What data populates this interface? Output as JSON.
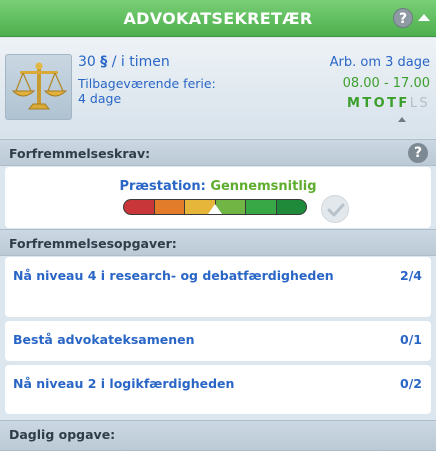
{
  "header": {
    "title": "Advokatsekretær",
    "help_label": "?",
    "collapse_icon": "chevron-up-icon"
  },
  "career": {
    "icon": "scales-of-justice-icon",
    "wage_amount": "30",
    "wage_currency": "§",
    "wage_unit": "/ i timen",
    "vacation_label": "Tilbageværende ferie:",
    "vacation_value": "4 dage",
    "work_in": "Arb. om 3 dage",
    "work_hours": "08.00 - 17.00",
    "days": [
      {
        "letter": "M",
        "active": true
      },
      {
        "letter": "T",
        "active": true
      },
      {
        "letter": "O",
        "active": true
      },
      {
        "letter": "T",
        "active": true
      },
      {
        "letter": "F",
        "active": true
      },
      {
        "letter": "L",
        "active": false
      },
      {
        "letter": "S",
        "active": false
      }
    ]
  },
  "promotion": {
    "section_title": "Forfremmelseskrav:",
    "help_label": "?",
    "performance_label": "Præstation:",
    "performance_value": "Gennemsnitlig",
    "performance_level": 0.5,
    "meter_colors": [
      "#c8363a",
      "#e27b2a",
      "#e6b63a",
      "#71b544",
      "#38a847",
      "#1f8a3a"
    ]
  },
  "tasks": {
    "section_title": "Forfremmelsesopgaver:",
    "items": [
      {
        "label": "Nå niveau 4 i research- og debatfærdigheden",
        "progress": "2/4"
      },
      {
        "label": "Bestå advokateksamenen",
        "progress": "0/1"
      },
      {
        "label": "Nå niveau 2 i logikfærdigheden",
        "progress": "0/2"
      }
    ]
  },
  "daily": {
    "section_title": "Daglig opgave:"
  }
}
